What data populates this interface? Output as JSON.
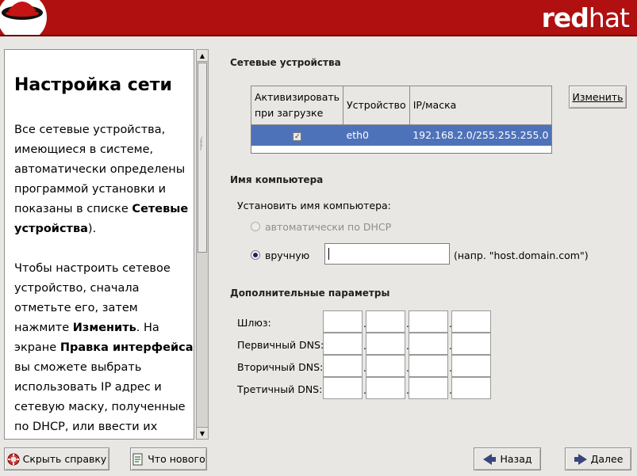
{
  "header": {
    "brand_bold": "red",
    "brand_thin": "hat"
  },
  "help": {
    "title": "Настройка сети",
    "p1_text": "Все сетевые устройства, имеющиеся в системе, автоматически определены программой установки и показаны в списке ",
    "p1_bold": "Сетевые устройства",
    "p1_tail": ").",
    "p2_a": "Чтобы настроить сетевое устройство, сначала отметьте его, затем нажмите ",
    "p2_b1": "Изменить",
    "p2_c": ". На экране ",
    "p2_b2": "Правка интерфейса",
    "p2_d": " вы сможете выбрать использовать IP адрес и сетевую маску, полученные по DHCP, или ввести их"
  },
  "devices": {
    "section_title": "Сетевые устройства",
    "columns": [
      "Активизировать при загрузке",
      "Устройство",
      "IP/маска"
    ],
    "rows": [
      {
        "active": true,
        "device": "eth0",
        "ip_mask": "192.168.2.0/255.255.255.0"
      }
    ],
    "edit_button": "Изменить"
  },
  "hostname": {
    "section_title": "Имя компьютера",
    "set_label": "Установить имя компьютера:",
    "option_dhcp": "автоматически по DHCP",
    "option_manual": "вручную",
    "manual_value": "",
    "example": "(напр. \"host.domain.com\")"
  },
  "extra": {
    "section_title": "Дополнительные параметры",
    "gateway": "Шлюз:",
    "dns1": "Первичный DNS:",
    "dns2": "Вторичный DNS:",
    "dns3": "Третичный DNS:"
  },
  "footer": {
    "hide_help": "Скрыть справку",
    "whats_new": "Что нового",
    "back": "Назад",
    "next": "Далее"
  },
  "colors": {
    "header_red": "#b01010",
    "selection_blue": "#4e72b9"
  }
}
